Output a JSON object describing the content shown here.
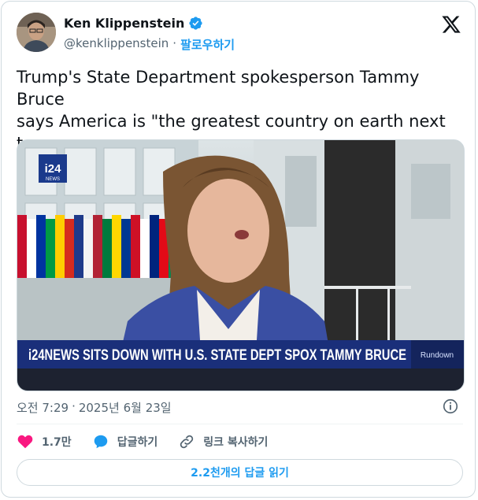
{
  "author": {
    "name": "Ken Klippenstein",
    "handle": "@kenklippenstein",
    "separator": "·",
    "follow_label": "팔로우하기"
  },
  "tweet": {
    "text": "Trump's State Department spokesperson Tammy Bruce\nsays America is \"the greatest country on earth next to\nIsrael\""
  },
  "media": {
    "channel_logo": "i24",
    "channel_logo_sub": "NEWS",
    "chyron": "i24NEWS SITS DOWN WITH U.S. STATE DEPT SPOX TAMMY BRUCE",
    "program": "Rundown"
  },
  "meta": {
    "time": "오전 7:29",
    "separator": "·",
    "date": "2025년 6월 23일"
  },
  "actions": {
    "likes": "1.7만",
    "reply_label": "답글하기",
    "copy_link_label": "링크 복사하기"
  },
  "read_replies_label": "2.2천개의 답글 읽기",
  "colors": {
    "accent": "#1d9bf0",
    "like": "#f91880",
    "text": "#0f1419",
    "muted": "#536471",
    "chyron_bg": "#1a2f7a"
  },
  "icons": {
    "verified": "verified-badge-icon",
    "logo": "x-logo-icon",
    "info": "info-icon",
    "like": "heart-icon",
    "reply": "speech-bubble-icon",
    "link": "link-icon"
  }
}
